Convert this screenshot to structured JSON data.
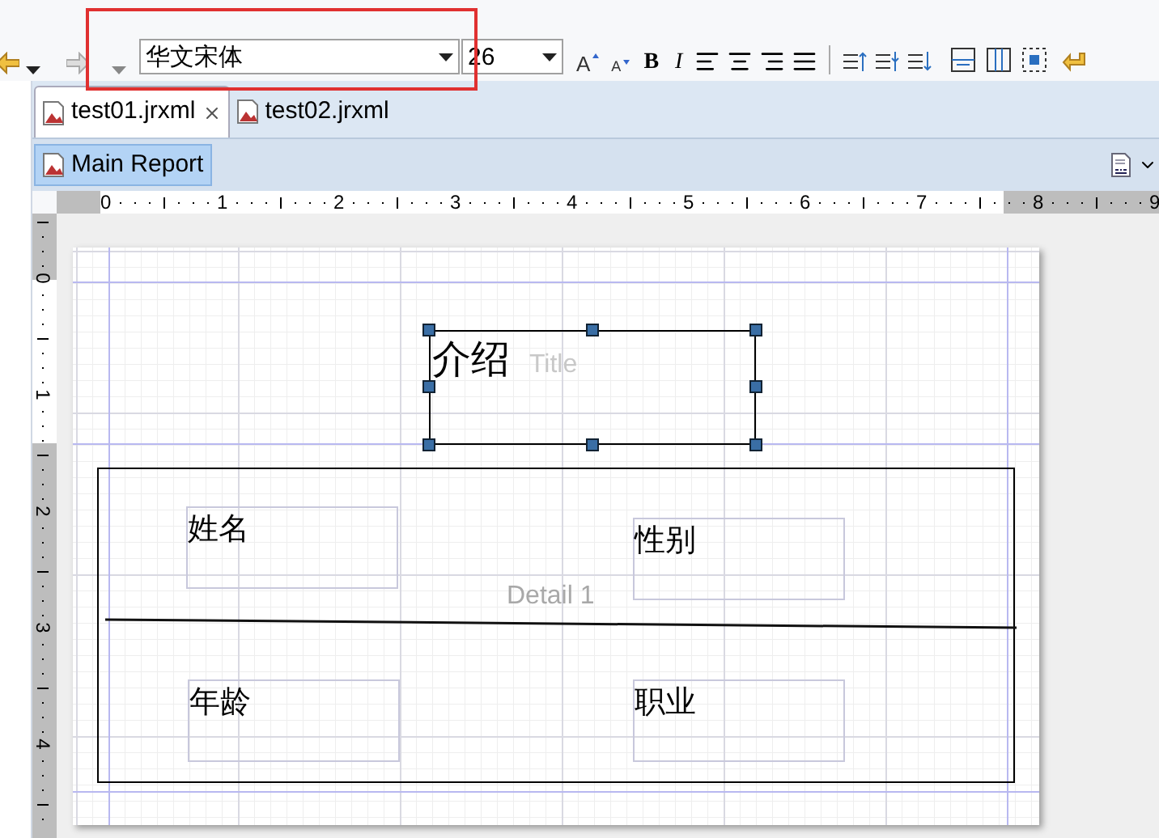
{
  "toolbar": {
    "font_family": "华文宋体",
    "font_size": "26",
    "grow_font": "A",
    "shrink_font": "A",
    "bold": "B",
    "italic": "I"
  },
  "tabs": [
    {
      "label": "test01.jrxml",
      "selected": true,
      "closable": true
    },
    {
      "label": "test02.jrxml",
      "selected": false,
      "closable": false
    }
  ],
  "report_tab": {
    "label": "Main Report",
    "selected": true
  },
  "ruler": {
    "horizontal": [
      "0",
      "1",
      "2",
      "3",
      "4",
      "5",
      "6",
      "7",
      "8",
      "9"
    ],
    "vertical": [
      "0",
      "1",
      "2",
      "3",
      "4"
    ]
  },
  "report": {
    "title_band": {
      "label": "Title",
      "element": {
        "text": "介绍",
        "selected": true
      }
    },
    "detail_band": {
      "label": "Detail 1",
      "fields": [
        {
          "text": "姓名"
        },
        {
          "text": "性别"
        },
        {
          "text": "年龄"
        },
        {
          "text": "职业"
        }
      ]
    }
  }
}
